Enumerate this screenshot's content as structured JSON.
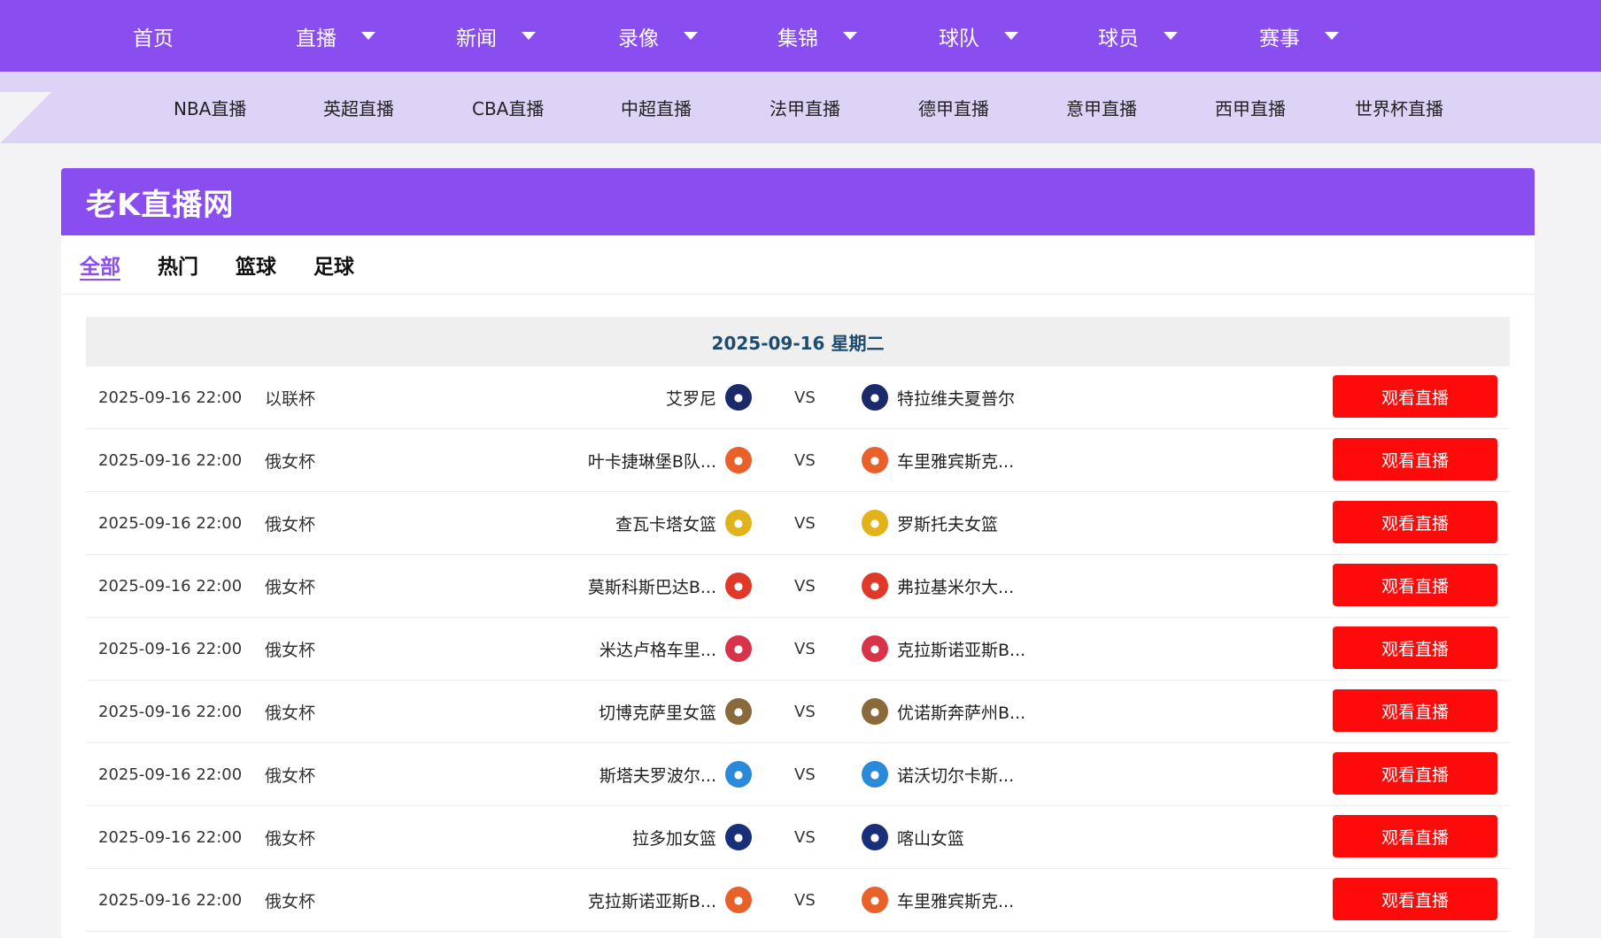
{
  "topnav": [
    {
      "label": "首页",
      "dropdown": false
    },
    {
      "label": "直播",
      "dropdown": true
    },
    {
      "label": "新闻",
      "dropdown": true
    },
    {
      "label": "录像",
      "dropdown": true
    },
    {
      "label": "集锦",
      "dropdown": true
    },
    {
      "label": "球队",
      "dropdown": true
    },
    {
      "label": "球员",
      "dropdown": true
    },
    {
      "label": "赛事",
      "dropdown": true
    }
  ],
  "subnav": [
    "NBA直播",
    "英超直播",
    "CBA直播",
    "中超直播",
    "法甲直播",
    "德甲直播",
    "意甲直播",
    "西甲直播",
    "世界杯直播"
  ],
  "site_title": "老K直播网",
  "tabs": [
    {
      "label": "全部",
      "active": true
    },
    {
      "label": "热门",
      "active": false
    },
    {
      "label": "篮球",
      "active": false
    },
    {
      "label": "足球",
      "active": false
    }
  ],
  "date_header": "2025-09-16 星期二",
  "vs_label": "VS",
  "watch_label": "观看直播",
  "colors": {
    "accent": "#8a4ef0",
    "subnav": "#dcd3f6",
    "button": "#ff0a0a"
  },
  "matches": [
    {
      "time": "2025-09-16 22:00",
      "league": "以联杯",
      "home": "艾罗尼",
      "away": "特拉维夫夏普尔",
      "home_color": "#1b2a6b",
      "away_color": "#1b2a6b"
    },
    {
      "time": "2025-09-16 22:00",
      "league": "俄女杯",
      "home": "叶卡捷琳堡B队...",
      "away": "车里雅宾斯克...",
      "home_color": "#e8602a",
      "away_color": "#e8602a"
    },
    {
      "time": "2025-09-16 22:00",
      "league": "俄女杯",
      "home": "查瓦卡塔女篮",
      "away": "罗斯托夫女篮",
      "home_color": "#e2b21a",
      "away_color": "#e2b21a"
    },
    {
      "time": "2025-09-16 22:00",
      "league": "俄女杯",
      "home": "莫斯科斯巴达B...",
      "away": "弗拉基米尔大...",
      "home_color": "#e0392a",
      "away_color": "#e0392a"
    },
    {
      "time": "2025-09-16 22:00",
      "league": "俄女杯",
      "home": "米达卢格车里...",
      "away": "克拉斯诺亚斯B...",
      "home_color": "#d9334a",
      "away_color": "#d9334a"
    },
    {
      "time": "2025-09-16 22:00",
      "league": "俄女杯",
      "home": "切博克萨里女篮",
      "away": "优诺斯奔萨州B...",
      "home_color": "#8a6a3a",
      "away_color": "#8a6a3a"
    },
    {
      "time": "2025-09-16 22:00",
      "league": "俄女杯",
      "home": "斯塔夫罗波尔...",
      "away": "诺沃切尔卡斯...",
      "home_color": "#2a8ad9",
      "away_color": "#2a8ad9"
    },
    {
      "time": "2025-09-16 22:00",
      "league": "俄女杯",
      "home": "拉多加女篮",
      "away": "喀山女篮",
      "home_color": "#1a2f7a",
      "away_color": "#1a2f7a"
    },
    {
      "time": "2025-09-16 22:00",
      "league": "俄女杯",
      "home": "克拉斯诺亚斯B...",
      "away": "车里雅宾斯克...",
      "home_color": "#e8602a",
      "away_color": "#e8602a"
    }
  ]
}
